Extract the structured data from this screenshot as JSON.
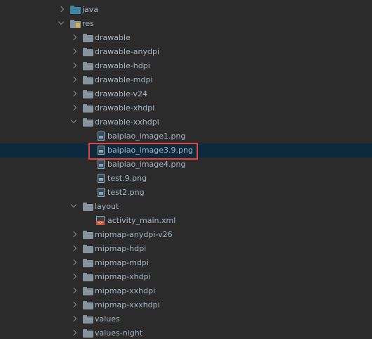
{
  "tree": {
    "items": [
      {
        "label": "java",
        "level": 0,
        "expand": "collapsed",
        "icon": "folder-blue-icon"
      },
      {
        "label": "res",
        "level": 0,
        "expand": "expanded",
        "icon": "folder-resource-icon"
      },
      {
        "label": "drawable",
        "level": 1,
        "expand": "collapsed",
        "icon": "folder-icon"
      },
      {
        "label": "drawable-anydpi",
        "level": 1,
        "expand": "collapsed",
        "icon": "folder-icon"
      },
      {
        "label": "drawable-hdpi",
        "level": 1,
        "expand": "collapsed",
        "icon": "folder-icon"
      },
      {
        "label": "drawable-mdpi",
        "level": 1,
        "expand": "collapsed",
        "icon": "folder-icon"
      },
      {
        "label": "drawable-v24",
        "level": 1,
        "expand": "collapsed",
        "icon": "folder-icon"
      },
      {
        "label": "drawable-xhdpi",
        "level": 1,
        "expand": "collapsed",
        "icon": "folder-icon"
      },
      {
        "label": "drawable-xxhdpi",
        "level": 1,
        "expand": "expanded",
        "icon": "folder-icon"
      },
      {
        "label": "baipiao_image1.png",
        "level": 2,
        "expand": "none",
        "icon": "image-file-icon"
      },
      {
        "label": "baipiao_image3.9.png",
        "level": 2,
        "expand": "none",
        "icon": "image-file-icon",
        "selected": true
      },
      {
        "label": "baipiao_image4.png",
        "level": 2,
        "expand": "none",
        "icon": "image-file-icon"
      },
      {
        "label": "test.9.png",
        "level": 2,
        "expand": "none",
        "icon": "image-file-icon"
      },
      {
        "label": "test2.png",
        "level": 2,
        "expand": "none",
        "icon": "image-file-icon"
      },
      {
        "label": "layout",
        "level": 1,
        "expand": "expanded",
        "icon": "folder-icon"
      },
      {
        "label": "activity_main.xml",
        "level": 2,
        "expand": "none",
        "icon": "xml-file-icon"
      },
      {
        "label": "mipmap-anydpi-v26",
        "level": 1,
        "expand": "collapsed",
        "icon": "folder-icon"
      },
      {
        "label": "mipmap-hdpi",
        "level": 1,
        "expand": "collapsed",
        "icon": "folder-icon"
      },
      {
        "label": "mipmap-mdpi",
        "level": 1,
        "expand": "collapsed",
        "icon": "folder-icon"
      },
      {
        "label": "mipmap-xhdpi",
        "level": 1,
        "expand": "collapsed",
        "icon": "folder-icon"
      },
      {
        "label": "mipmap-xxhdpi",
        "level": 1,
        "expand": "collapsed",
        "icon": "folder-icon"
      },
      {
        "label": "mipmap-xxxhdpi",
        "level": 1,
        "expand": "collapsed",
        "icon": "folder-icon"
      },
      {
        "label": "values",
        "level": 1,
        "expand": "collapsed",
        "icon": "folder-icon"
      },
      {
        "label": "values-night",
        "level": 1,
        "expand": "collapsed",
        "icon": "folder-icon"
      }
    ]
  },
  "colors": {
    "background": "#2b2b2b",
    "selection": "#0d293e",
    "highlight_border": "#e0443b",
    "text": "#a9b7c6"
  }
}
